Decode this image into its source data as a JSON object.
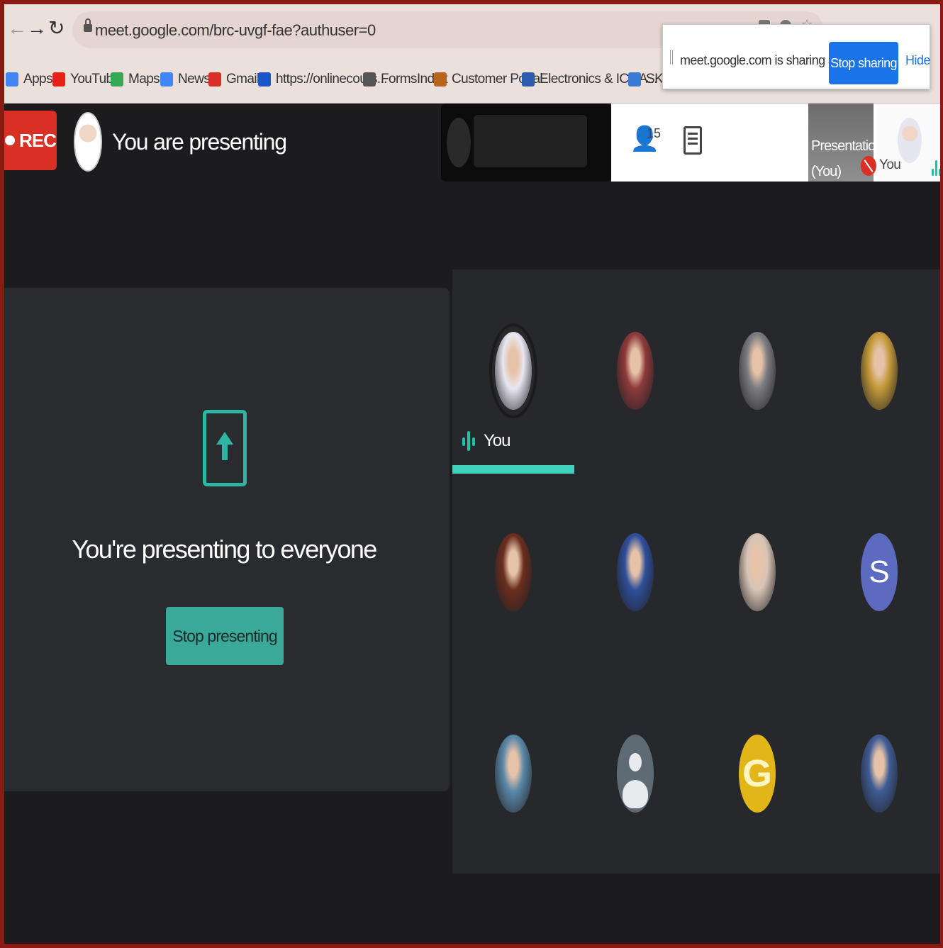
{
  "browser": {
    "url": "meet.google.com/brc-uvgf-fae?authuser=0",
    "bookmarks": [
      {
        "label": "Apps",
        "icon": "apps-grid-icon",
        "color": "#4285f4"
      },
      {
        "label": "YouTube",
        "icon": "youtube-icon",
        "color": "#e62117"
      },
      {
        "label": "Maps",
        "icon": "maps-icon",
        "color": "#34a853"
      },
      {
        "label": "News",
        "icon": "news-icon",
        "color": "#4285f4"
      },
      {
        "label": "Gmail",
        "icon": "gmail-icon",
        "color": "#d93025"
      },
      {
        "label": "https://onlinecours...",
        "icon": "link-icon",
        "color": "#1a56c8"
      },
      {
        "label": "FormsIndex",
        "icon": "forms-icon",
        "color": "#555555"
      },
      {
        "label": "Customer Portal",
        "icon": "portal-icon",
        "color": "#b5651d"
      },
      {
        "label": "Electronics & ICT A...",
        "icon": "electronics-icon",
        "color": "#2a5db0"
      },
      {
        "label": "SKCT",
        "icon": "skct-icon",
        "color": "#3a7bd5"
      }
    ]
  },
  "share_popup": {
    "message": "meet.google.com is sharing a window.",
    "stop_label": "Stop sharing",
    "hide_label": "Hide"
  },
  "meet_header": {
    "rec_label": "REC",
    "presenting_label": "You are presenting",
    "people_count": "15",
    "presentation_label": "Presentation (You)",
    "you_label": "You"
  },
  "presenting_panel": {
    "message": "You're presenting to everyone",
    "stop_label": "Stop presenting"
  },
  "participants": [
    {
      "name": "You",
      "avatar": "photo",
      "color": "#e9e7f2",
      "is_self": true
    },
    {
      "name": "",
      "avatar": "photo",
      "color": "#8c3a3a"
    },
    {
      "name": "",
      "avatar": "photo",
      "color": "#7b7b80"
    },
    {
      "name": "",
      "avatar": "photo",
      "color": "#c49a3a"
    },
    {
      "name": "",
      "avatar": "photo",
      "color": "#6b2e1e"
    },
    {
      "name": "",
      "avatar": "photo",
      "color": "#2f4f9a"
    },
    {
      "name": "",
      "avatar": "photo",
      "color": "#d8c4b6"
    },
    {
      "name": "",
      "avatar": "letter",
      "letter": "S",
      "color": "#5c6bc0"
    },
    {
      "name": "",
      "avatar": "photo",
      "color": "#5a88a8"
    },
    {
      "name": "",
      "avatar": "default",
      "color": "#5f6b74"
    },
    {
      "name": "",
      "avatar": "letter",
      "letter": "G",
      "color": "#e2b619"
    },
    {
      "name": "",
      "avatar": "photo",
      "color": "#3f5c95"
    }
  ]
}
